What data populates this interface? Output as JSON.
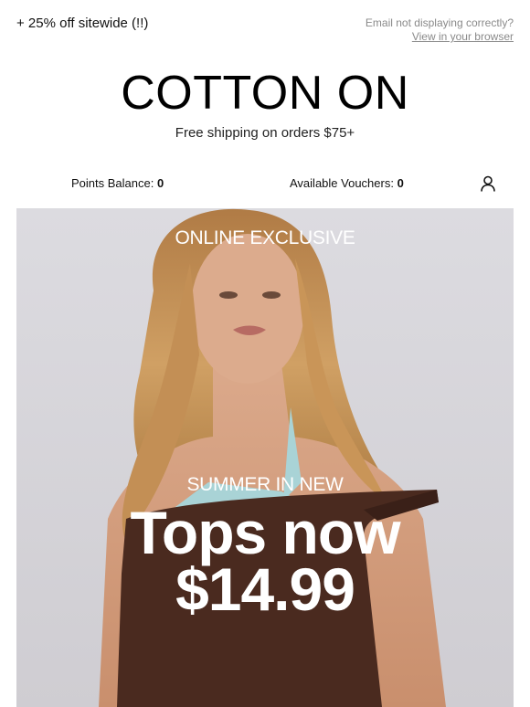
{
  "header": {
    "promo_text": "+ 25% off sitewide (!!)",
    "browser_note": "Email not displaying correctly?",
    "browser_link": "View in your browser"
  },
  "brand": {
    "logo_text": "COTTON ON",
    "shipping_text": "Free shipping on orders $75+"
  },
  "account": {
    "points_label": "Points Balance:",
    "points_value": "0",
    "vouchers_label": "Available Vouchers:",
    "vouchers_value": "0",
    "icon": "user-icon"
  },
  "hero": {
    "eyebrow": "ONLINE EXCLUSIVE",
    "subheading": "SUMMER IN NEW",
    "headline_line1": "Tops now",
    "headline_line2": "$14.99"
  },
  "colors": {
    "background": "#ffffff",
    "muted_text": "#8a8a8a",
    "hero_backdrop": "#d7d6db",
    "top_brown": "#4a2a1f",
    "hair": "#c9955a",
    "skin": "#d9a585"
  }
}
